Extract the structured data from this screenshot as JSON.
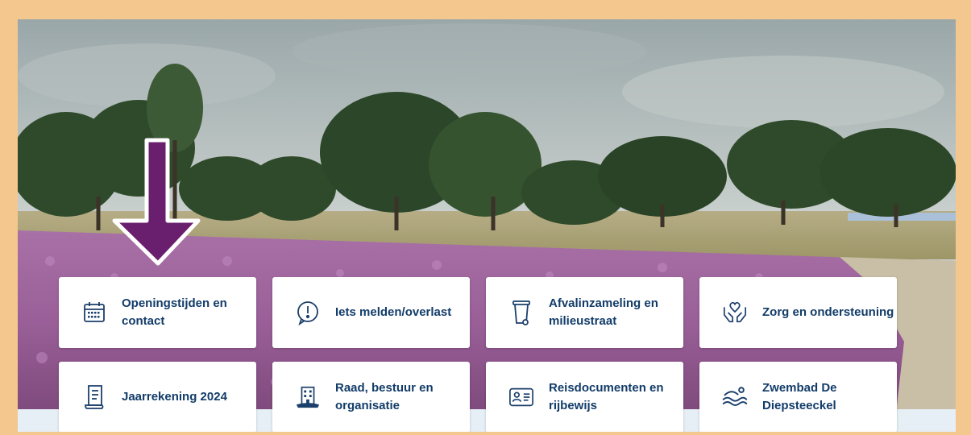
{
  "colors": {
    "frame": "#f4c78f",
    "tile_text": "#123c69",
    "icon": "#1b3f6b",
    "arrow_fill": "#6a1f6e",
    "arrow_outline": "#ffffff"
  },
  "hero": {
    "image_alt": "Heideveld met paarse heide en bomen"
  },
  "annotation": {
    "arrow": "pointing-down-arrow"
  },
  "tiles": [
    {
      "label": "Openingstijden en contact",
      "icon": "calendar-icon"
    },
    {
      "label": "Iets melden/overlast",
      "icon": "exclamation-circle-icon"
    },
    {
      "label": "Afvalinzameling en milieustraat",
      "icon": "trash-bin-icon"
    },
    {
      "label": "Zorg en ondersteuning",
      "icon": "hands-heart-icon"
    },
    {
      "label": "Jaarrekening 2024",
      "icon": "document-scroll-icon"
    },
    {
      "label": "Raad, bestuur en organisatie",
      "icon": "town-hall-icon"
    },
    {
      "label": "Reisdocumenten en rijbewijs",
      "icon": "id-card-icon"
    },
    {
      "label": "Zwembad De Diepsteeckel",
      "icon": "swimming-icon"
    }
  ]
}
